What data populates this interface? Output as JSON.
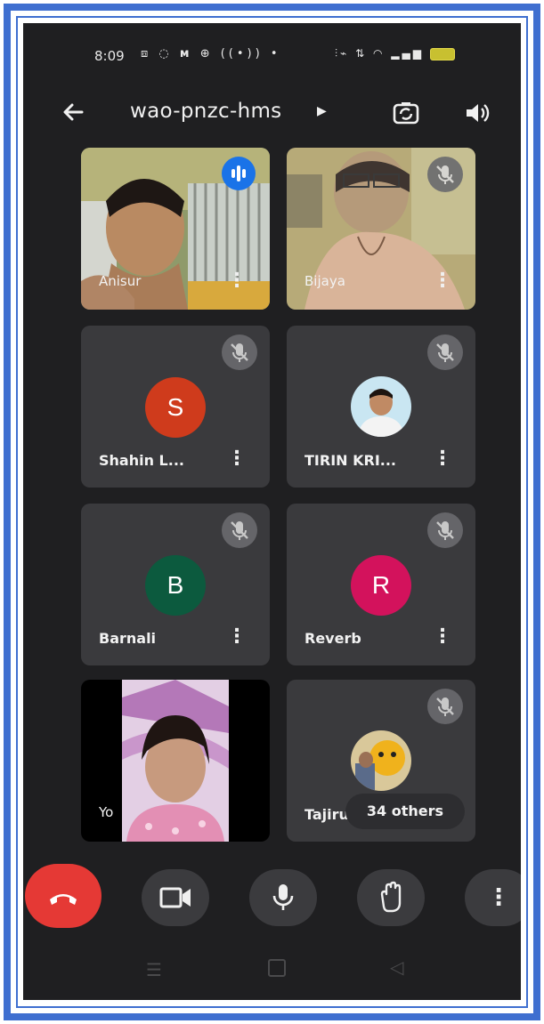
{
  "status_bar": {
    "time": "8:09",
    "left_icons": [
      "screen-record-icon",
      "whatsapp-icon",
      "m-icon",
      "chrome-icon",
      "radio-icon",
      "dot-icon"
    ],
    "right_icons": [
      "vibrate-icon",
      "data-icon",
      "wifi-icon",
      "signal-icon",
      "battery-icon"
    ]
  },
  "header": {
    "title": "wao-pnzc-hms"
  },
  "participants": [
    {
      "name": "Anisur",
      "type": "video",
      "speaking": true
    },
    {
      "name": "Bijaya",
      "type": "video",
      "muted": true
    },
    {
      "name": "Shahin L...",
      "type": "letter",
      "letter": "S",
      "color": "#cf3b1c",
      "muted": true
    },
    {
      "name": "TIRIN KRI...",
      "type": "photo",
      "muted": true
    },
    {
      "name": "Barnali",
      "type": "letter",
      "letter": "B",
      "color": "#0c5a3e",
      "muted": true
    },
    {
      "name": "Reverb",
      "type": "letter",
      "letter": "R",
      "color": "#d3125c",
      "muted": true
    },
    {
      "name": "Yo",
      "type": "video"
    },
    {
      "name": "Tajiru",
      "type": "photo",
      "muted": true,
      "others_label": "34 others"
    }
  ],
  "controls": {
    "end_call": "end-call",
    "camera": "camera",
    "mic": "microphone",
    "raise_hand": "raise-hand",
    "more": "more-options"
  },
  "colors": {
    "screen_bg": "#1f1f21",
    "tile_bg": "#3a3a3d",
    "end_call_red": "#e53935",
    "frame_blue": "#3f6fd0",
    "speaking_blue": "#1a73e8"
  }
}
